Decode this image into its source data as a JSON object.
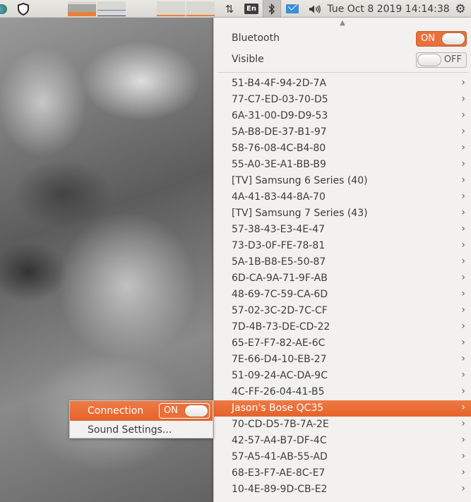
{
  "panel": {
    "keyboard_layout": "En",
    "clock": "Tue Oct  8 2019 14:14:38",
    "icons": [
      "globe-icon",
      "shield-icon",
      "system-monitor-graph",
      "network-arrows-icon",
      "bluetooth-icon",
      "mail-icon",
      "volume-icon",
      "gear-icon"
    ],
    "accent_color": "#e9703a"
  },
  "bluetooth_menu": {
    "bluetooth_label": "Bluetooth",
    "bluetooth_state": "ON",
    "visible_label": "Visible",
    "visible_state": "OFF",
    "devices": [
      "51-B4-4F-94-2D-7A",
      "77-C7-ED-03-70-D5",
      "6A-31-00-D9-D9-53",
      "5A-B8-DE-37-B1-97",
      "58-76-08-4C-B4-80",
      "55-A0-3E-A1-BB-B9",
      "[TV] Samsung 6 Series (40)",
      "4A-41-83-44-8A-70",
      "[TV] Samsung 7 Series (43)",
      "57-38-43-E3-4E-47",
      "73-D3-0F-FE-78-81",
      "5A-1B-B8-E5-50-87",
      "6D-CA-9A-71-9F-AB",
      "48-69-7C-59-CA-6D",
      "57-02-3C-2D-7C-CF",
      "7D-4B-73-DE-CD-22",
      "65-E7-F7-82-AE-6C",
      "7E-66-D4-10-EB-27",
      "51-09-24-AC-DA-9C",
      "4C-FF-26-04-41-B5",
      "Jason's Bose QC35",
      "70-CD-D5-7B-7A-2E",
      "42-57-A4-B7-DF-4C",
      "57-A5-41-AB-55-AD",
      "68-E3-F7-AE-8C-E7",
      "10-4E-89-9D-CB-E2"
    ],
    "selected_device": "Jason's Bose QC35"
  },
  "device_submenu": {
    "connection_label": "Connection",
    "connection_state": "ON",
    "sound_settings_label": "Sound Settings..."
  }
}
